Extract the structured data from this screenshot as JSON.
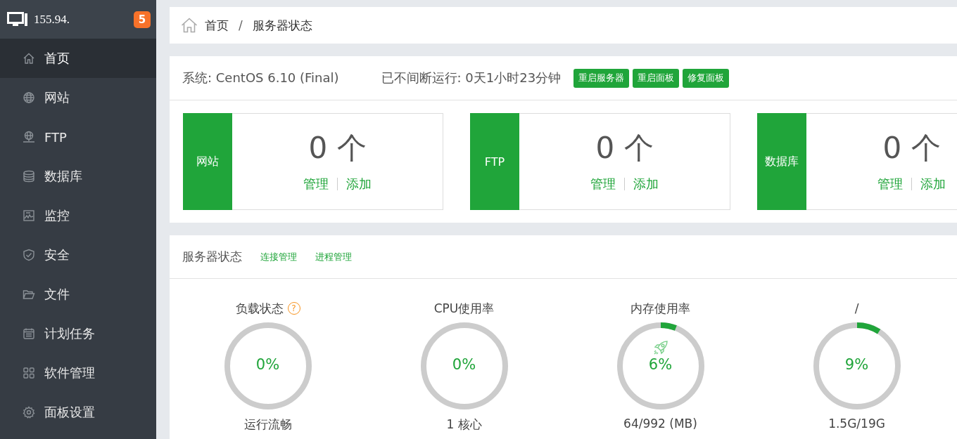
{
  "sidebar": {
    "host": "155.94.",
    "badge": "5",
    "items": [
      {
        "label": "首页",
        "selected": true
      },
      {
        "label": "网站",
        "selected": false
      },
      {
        "label": "FTP",
        "selected": false
      },
      {
        "label": "数据库",
        "selected": false
      },
      {
        "label": "监控",
        "selected": false
      },
      {
        "label": "安全",
        "selected": false
      },
      {
        "label": "文件",
        "selected": false
      },
      {
        "label": "计划任务",
        "selected": false
      },
      {
        "label": "软件管理",
        "selected": false
      },
      {
        "label": "面板设置",
        "selected": false
      }
    ]
  },
  "breadcrumb": [
    "首页",
    "/",
    "服务器状态"
  ],
  "system": {
    "os": "系统: CentOS 6.10 (Final)",
    "uptime": "已不间断运行: 0天1小时23分钟",
    "buttons": [
      "重启服务器",
      "重启面板",
      "修复面板"
    ]
  },
  "stat_cards": [
    {
      "label": "网站",
      "count": "0 个",
      "links": [
        "管理",
        "添加"
      ]
    },
    {
      "label": "FTP",
      "count": "0 个",
      "links": [
        "管理",
        "添加"
      ]
    },
    {
      "label": "数据库",
      "count": "0 个",
      "links": [
        "管理",
        "添加"
      ]
    }
  ],
  "status": {
    "title": "服务器状态",
    "links": [
      "连接管理",
      "进程管理"
    ],
    "gauges": [
      {
        "title": "负载状态",
        "help": "?",
        "rocket": false,
        "level": 0,
        "reading": "0%",
        "caption": "运行流畅"
      },
      {
        "title": "CPU使用率",
        "rocket": false,
        "level": 0,
        "reading": "0%",
        "caption": "1 核心"
      },
      {
        "title": "内存使用率",
        "rocket": true,
        "level": 0.06,
        "reading": "6%",
        "caption": "64/992 (MB)"
      },
      {
        "title": "/",
        "rocket": false,
        "level": 0.09,
        "reading": "9%",
        "caption": "1.5G/19G"
      }
    ]
  }
}
